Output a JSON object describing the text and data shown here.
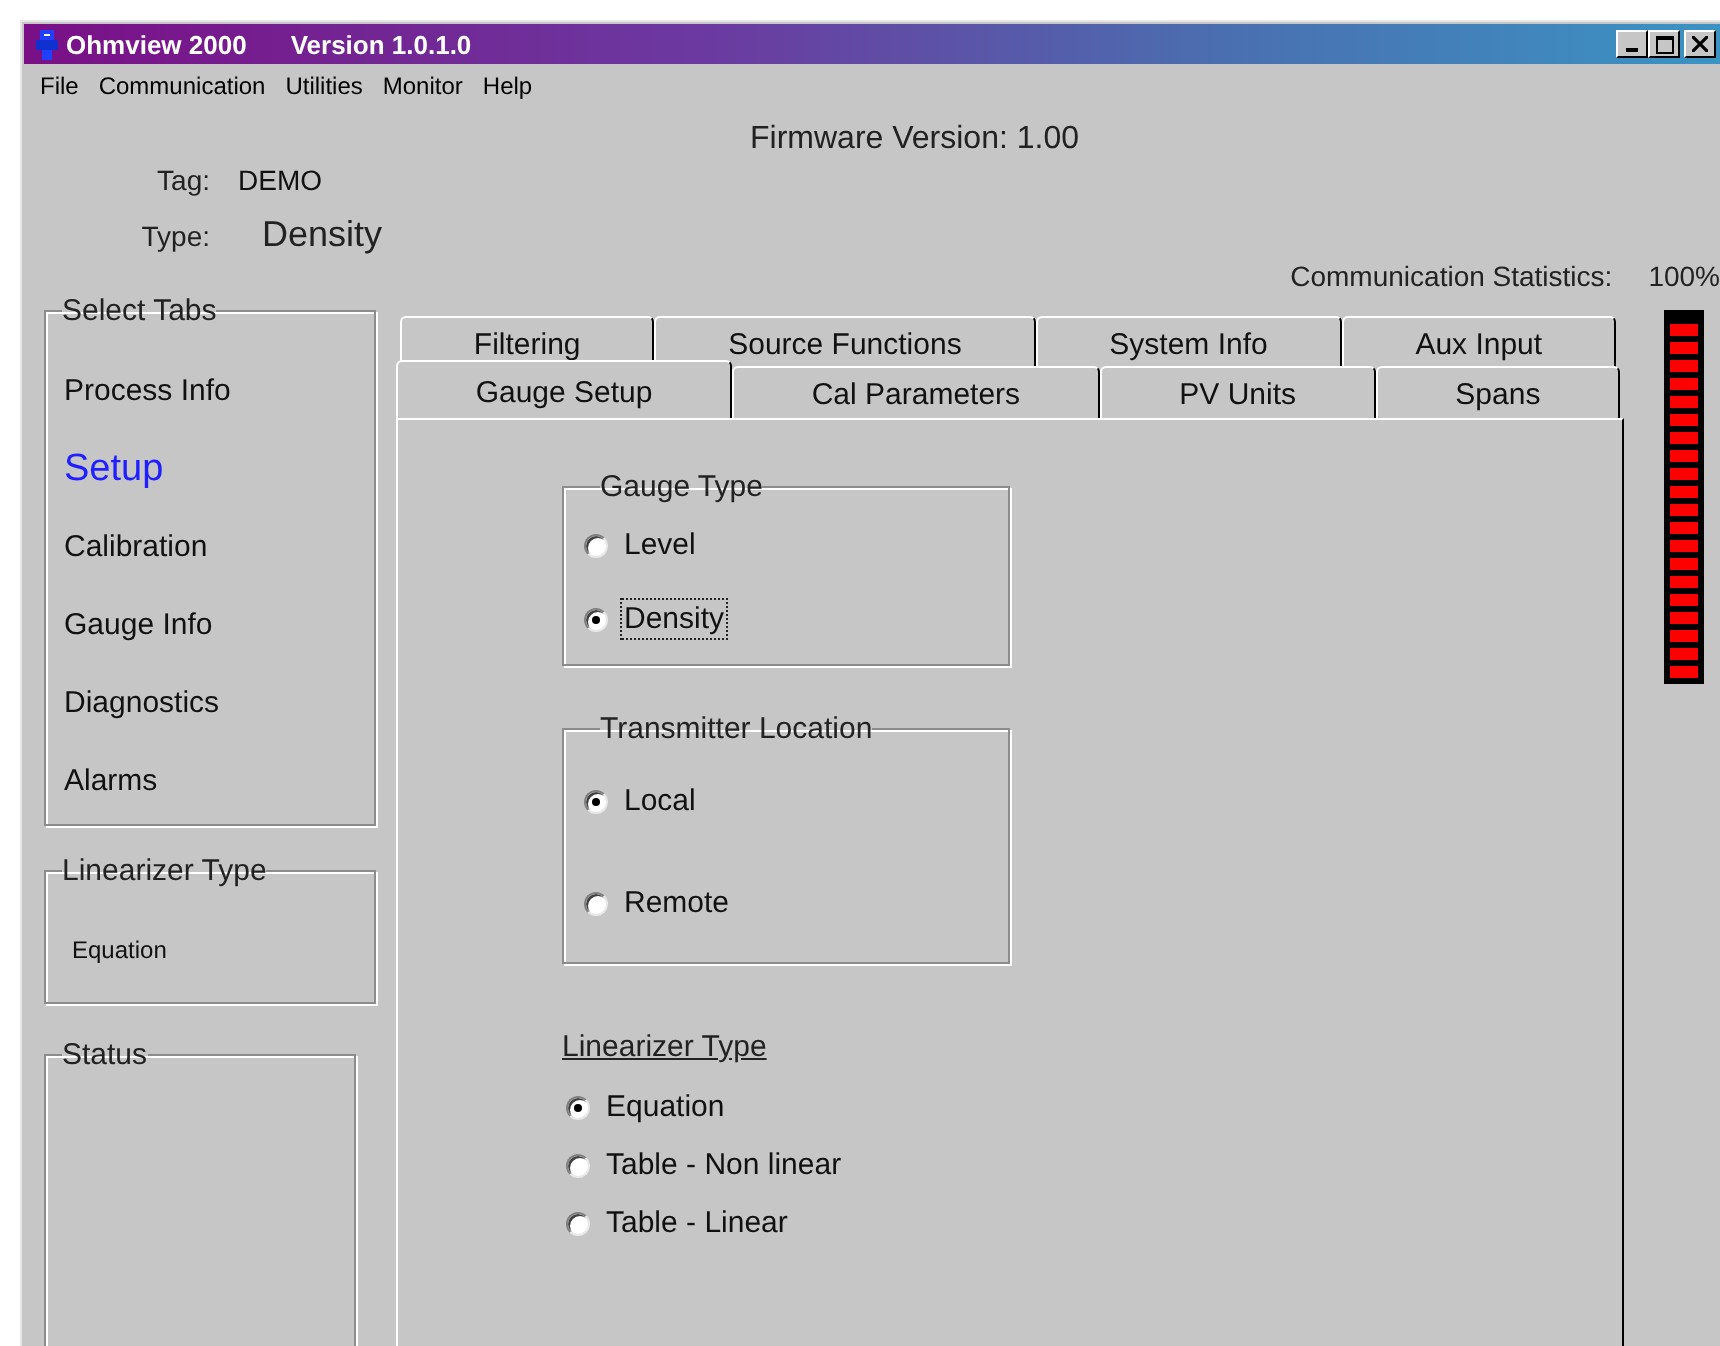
{
  "window": {
    "title": "Ohmview 2000",
    "version": "Version 1.0.1.0"
  },
  "menu": [
    "File",
    "Communication",
    "Utilities",
    "Monitor",
    "Help"
  ],
  "header": {
    "firmware": "Firmware Version: 1.00",
    "tag_label": "Tag:",
    "tag_value": "DEMO",
    "type_label": "Type:",
    "type_value": "Density",
    "comm_label": "Communication Statistics:",
    "comm_value": "100%"
  },
  "comm_meter": {
    "level": 1
  },
  "select_tabs": {
    "title": "Select Tabs",
    "items": [
      {
        "label": "Process Info",
        "selected": false
      },
      {
        "label": "Setup",
        "selected": true
      },
      {
        "label": "Calibration",
        "selected": false
      },
      {
        "label": "Gauge Info",
        "selected": false
      },
      {
        "label": "Diagnostics",
        "selected": false
      },
      {
        "label": "Alarms",
        "selected": false
      }
    ]
  },
  "linearizer_panel": {
    "title": "Linearizer Type",
    "value": "Equation"
  },
  "status_panel": {
    "title": "Status"
  },
  "tab_rows": [
    {
      "tabs": [
        {
          "label": "Filtering",
          "selected": false
        },
        {
          "label": "Source Functions",
          "selected": false
        },
        {
          "label": "System Info",
          "selected": false
        },
        {
          "label": "Aux Input",
          "selected": false
        }
      ]
    },
    {
      "tabs": [
        {
          "label": "Gauge Setup",
          "selected": true
        },
        {
          "label": "Cal Parameters",
          "selected": false
        },
        {
          "label": "PV Units",
          "selected": false
        },
        {
          "label": "Spans",
          "selected": false
        }
      ]
    }
  ],
  "groups": [
    {
      "kind": "box",
      "title": "Gauge Type",
      "options": [
        {
          "label": "Level",
          "selected": false,
          "focused": false
        },
        {
          "label": "Density",
          "selected": true,
          "focused": true
        }
      ]
    },
    {
      "kind": "box",
      "title": "Transmitter Location",
      "options": [
        {
          "label": "Local",
          "selected": true,
          "focused": false
        },
        {
          "label": "Remote",
          "selected": false,
          "focused": false
        }
      ]
    },
    {
      "kind": "plain",
      "title": "Linearizer Type",
      "options": [
        {
          "label": "Equation",
          "selected": true,
          "focused": false
        },
        {
          "label": "Table - Non linear",
          "selected": false,
          "focused": false
        },
        {
          "label": "Table - Linear",
          "selected": false,
          "focused": false
        }
      ]
    }
  ]
}
